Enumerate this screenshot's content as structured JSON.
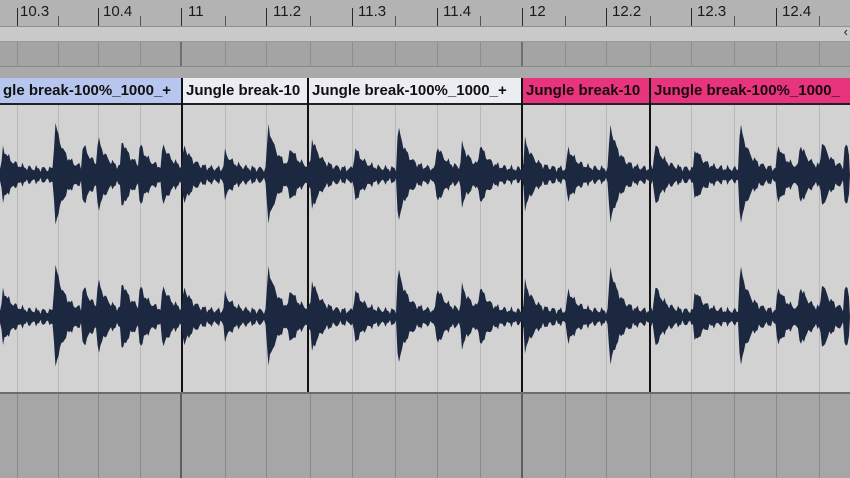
{
  "ruler": {
    "labels": [
      "10.3",
      "10.4",
      "11",
      "11.2",
      "11.3",
      "11.4",
      "12",
      "12.2",
      "12.3",
      "12.4"
    ]
  },
  "scroll": {
    "arrow": "‹"
  },
  "clips": [
    {
      "title": "gle break-100%_1000_+",
      "color": "#b7c6ef"
    },
    {
      "title": "Jungle break-10",
      "color": "#ececf3"
    },
    {
      "title": "Jungle break-100%_1000_+",
      "color": "#ececf3"
    },
    {
      "title": "Jungle break-10",
      "color": "#e8347c"
    },
    {
      "title": "Jungle break-100%_1000_",
      "color": "#e8347c"
    }
  ],
  "colors": {
    "waveform": "#1c2740",
    "clip_body": "#d2d2d2",
    "ruler": "#b3b3b3",
    "lower_track": "#a6a6a6"
  }
}
